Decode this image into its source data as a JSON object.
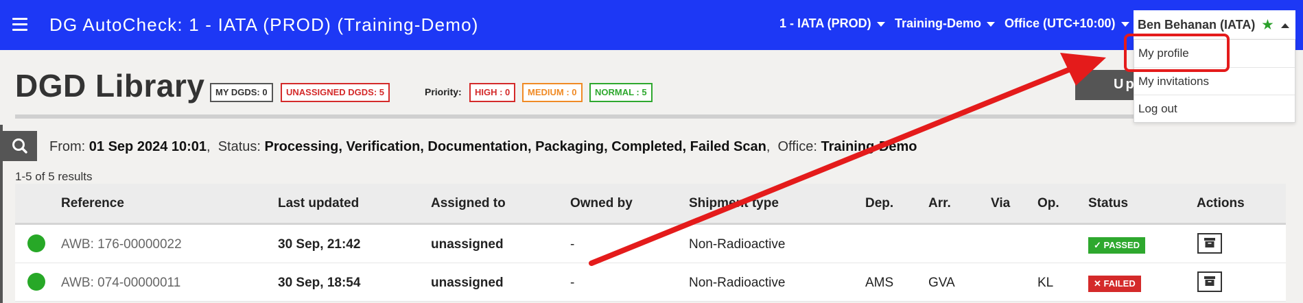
{
  "header": {
    "app_title": "DG AutoCheck: 1 - IATA (PROD) (Training-Demo)",
    "nav": {
      "account": "1 - IATA (PROD)",
      "workspace": "Training-Demo",
      "office": "Office (UTC+10:00)"
    },
    "user": {
      "name": "Ben Behanan (IATA)"
    },
    "icons": {
      "menu": "hamburger-icon",
      "favorite": "star-icon",
      "dropdown": "caret-down-icon"
    }
  },
  "user_dropdown": {
    "items": [
      {
        "label": "My profile"
      },
      {
        "label": "My invitations"
      },
      {
        "label": "Log out"
      }
    ]
  },
  "page": {
    "title": "DGD Library",
    "badges": {
      "my_dgds": "MY DGDS: 0",
      "unassigned": "UNASSIGNED DGDS: 5"
    },
    "priority_label": "Priority:",
    "priority": {
      "high": "HIGH : 0",
      "medium": "MEDIUM : 0",
      "normal": "NORMAL : 5"
    },
    "upload_label": "Upload"
  },
  "filter": {
    "from_label": "From:",
    "from_value": "01 Sep 2024 10:01",
    "status_label": "Status:",
    "status_value": "Processing, Verification, Documentation, Packaging, Completed, Failed Scan",
    "office_label": "Office:",
    "office_value": "Training-Demo",
    "results": "1-5 of 5 results"
  },
  "table": {
    "headers": {
      "reference": "Reference",
      "last_updated": "Last updated",
      "assigned_to": "Assigned to",
      "owned_by": "Owned by",
      "shipment_type": "Shipment type",
      "dep": "Dep.",
      "arr": "Arr.",
      "via": "Via",
      "op": "Op.",
      "status": "Status",
      "actions": "Actions"
    },
    "rows": [
      {
        "reference": "AWB: 176-00000022",
        "last_updated": "30 Sep, 21:42",
        "assigned_to": "unassigned",
        "owned_by": "-",
        "shipment_type": "Non-Radioactive",
        "dep": "",
        "arr": "",
        "via": "",
        "op": "",
        "status": "✓ PASSED",
        "status_color": "#2ea82e"
      },
      {
        "reference": "AWB: 074-00000011",
        "last_updated": "30 Sep, 18:54",
        "assigned_to": "unassigned",
        "owned_by": "-",
        "shipment_type": "Non-Radioactive",
        "dep": "AMS",
        "arr": "GVA",
        "via": "",
        "op": "KL",
        "status": "✕ FAILED",
        "status_color": "#d42a2a"
      }
    ]
  },
  "colors": {
    "topbar": "#1d38f5",
    "annotation": "#e41b1b",
    "my_dgds_border": "#555555",
    "unassigned_border": "#d42a2a",
    "high": "#d42a2a",
    "medium": "#f08a24",
    "normal": "#2ea82e"
  }
}
